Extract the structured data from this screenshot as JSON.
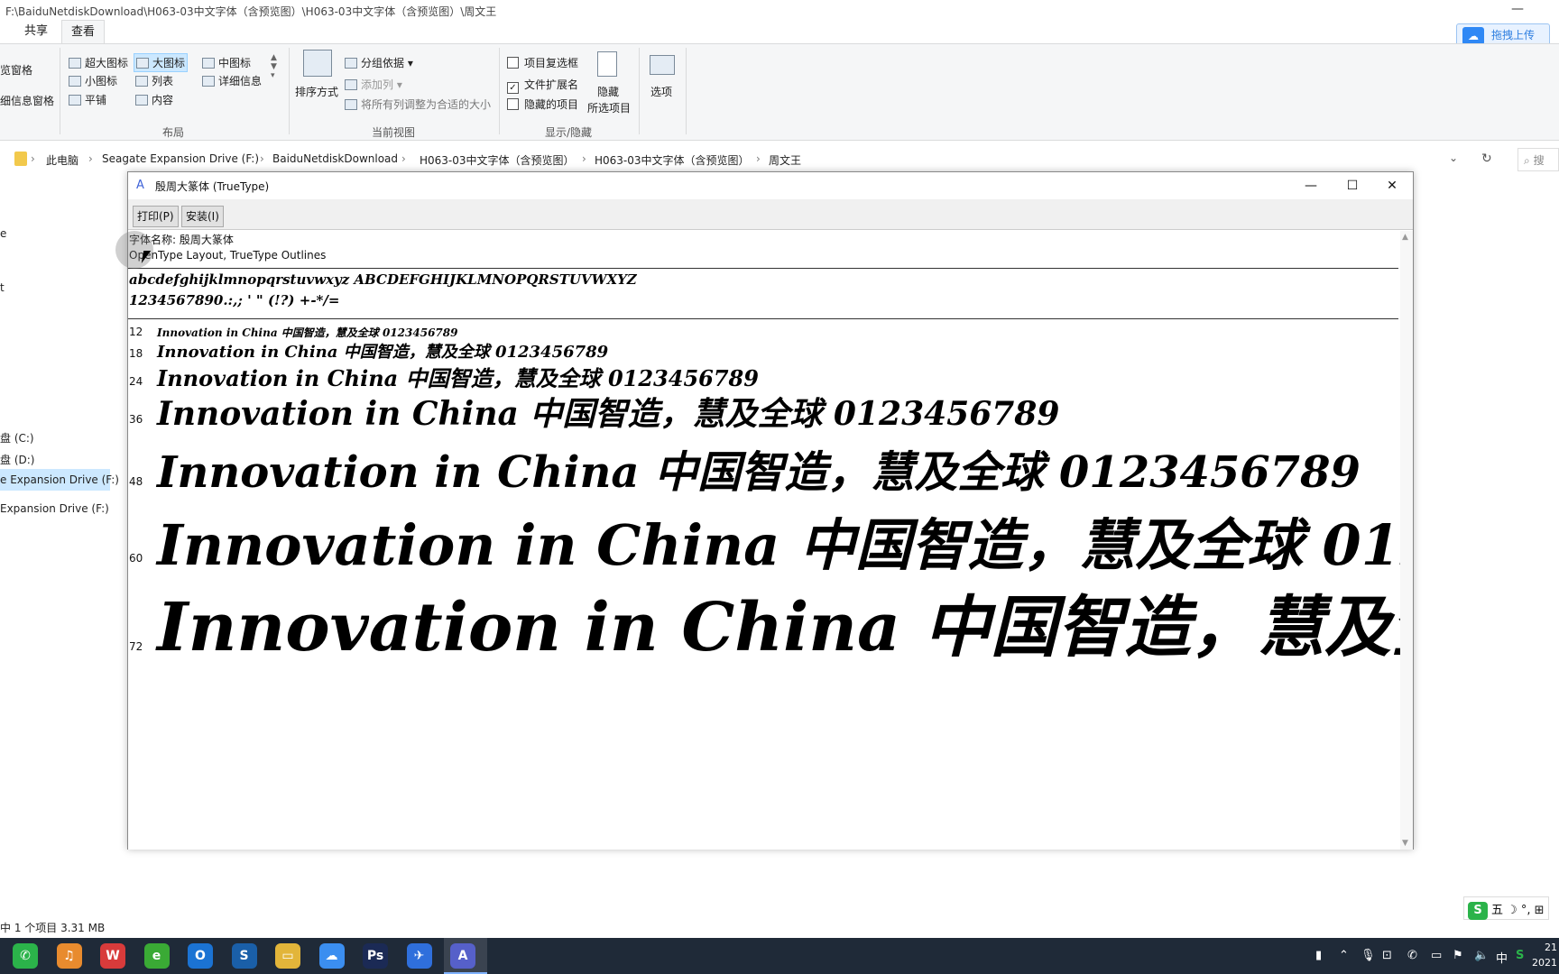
{
  "explorer": {
    "title_path": "F:\\BaiduNetdiskDownload\\H063-03中文字体（含预览图）\\H063-03中文字体（含预览图）\\周文王",
    "tabs": [
      "共享",
      "查看"
    ],
    "upload_button": "拖拽上传",
    "ribbon": {
      "pane_items": [
        "览窗格",
        "细信息窗格"
      ],
      "layout_items": [
        "超大图标",
        "大图标",
        "中图标",
        "小图标",
        "列表",
        "详细信息",
        "平铺",
        "内容"
      ],
      "layout_label": "布局",
      "sort_label": "排序方式",
      "group_by": "分组依据",
      "add_column": "添加列",
      "fit_columns": "将所有列调整为合适的大小",
      "current_view_label": "当前视图",
      "checkbox_items": [
        {
          "label": "项目复选框",
          "checked": false
        },
        {
          "label": "文件扩展名",
          "checked": true
        },
        {
          "label": "隐藏的项目",
          "checked": false
        }
      ],
      "hide_selected_1": "隐藏",
      "hide_selected_2": "所选项目",
      "show_hide_label": "显示/隐藏",
      "options": "选项"
    },
    "breadcrumbs": [
      "此电脑",
      "Seagate Expansion Drive (F:)",
      "BaiduNetdiskDownload",
      "H063-03中文字体（含预览图）",
      "H063-03中文字体（含预览图）",
      "周文王"
    ],
    "search_icon": "⌕",
    "search_text": "搜",
    "nav_items": [
      "e",
      "t",
      "盘 (C:)",
      "盘 (D:)",
      "e Expansion Drive (F:)",
      "Expansion Drive (F:)"
    ],
    "status": "中 1 个项目   3.31 MB"
  },
  "font_viewer": {
    "title": "殷周大篆体 (TrueType)",
    "print_button": "打印(P)",
    "install_button": "安装(I)",
    "font_name_line": "字体名称: 殷周大篆体",
    "font_type_line": "OpenType Layout, TrueType Outlines",
    "charset_line1": "abcdefghijklmnopqrstuvwxyz ABCDEFGHIJKLMNOPQRSTUVWXYZ",
    "charset_line2": "1234567890.:,; ' \" (!?) +-*/=",
    "sample_text": "Innovation in China 中国智造，慧及全球 0123456789",
    "sizes": [
      "12",
      "18",
      "24",
      "36",
      "48",
      "60",
      "72"
    ]
  },
  "ime": {
    "logo": "S",
    "text": "五 ☽ °, ⊞"
  },
  "taskbar": {
    "apps": [
      "wechat",
      "sound",
      "wps",
      "browser",
      "outlook",
      "sketchup",
      "explorer",
      "baidunetdisk",
      "photoshop",
      "feishu",
      "font-viewer"
    ],
    "app_glyphs": [
      "✆",
      "♫",
      "W",
      "e",
      "O",
      "S",
      "▭",
      "☁",
      "Ps",
      "✈",
      "A"
    ],
    "app_colors": [
      "#2bb34a",
      "#e88b2e",
      "#d83b3b",
      "#3aaa35",
      "#1b73d3",
      "#1a5fa8",
      "#e2b53a",
      "#3b8ef0",
      "#1b2a55",
      "#2f6fdc",
      "#5660c9"
    ],
    "tray_text": "中",
    "clock_time": "21",
    "clock_date": "2021"
  }
}
